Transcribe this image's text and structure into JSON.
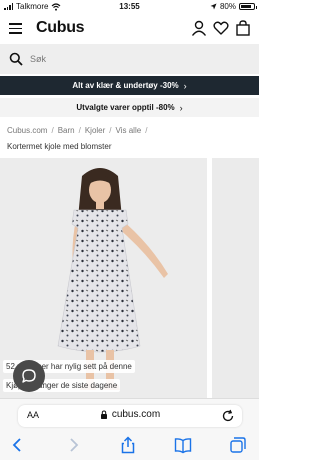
{
  "status_bar": {
    "carrier": "Talkmore",
    "time": "13:55",
    "battery": "80%",
    "battery_level": 0.8
  },
  "header": {
    "logo": "Cubus",
    "icons": [
      "menu-icon",
      "user-icon",
      "heart-icon",
      "shopping-bag-icon"
    ]
  },
  "search": {
    "placeholder": "Søk",
    "icon": "search-icon"
  },
  "promos": [
    {
      "text": "Alt av klær & undertøy -30%",
      "background": "#1e2831",
      "color": "#ffffff"
    },
    {
      "text": "Utvalgte varer opptil -80%",
      "background": "#f3f3f3",
      "color": "#111111"
    }
  ],
  "breadcrumb": [
    "Cubus.com",
    "Barn",
    "Kjoler",
    "Vis alle"
  ],
  "product": {
    "title": "Kortermet kjole med blomster",
    "badges": [
      "52 personer har nylig sett på denne",
      "Kjøpt 1 ganger de siste dagene"
    ]
  },
  "safari": {
    "text_size": "AA",
    "url": "cubus.com",
    "toolbar": [
      "back-icon",
      "forward-icon",
      "share-icon",
      "bookmarks-icon",
      "tabs-icon"
    ]
  },
  "colors": {
    "accent_blue": "#1a73e8",
    "promo_dark": "#1e2831"
  }
}
